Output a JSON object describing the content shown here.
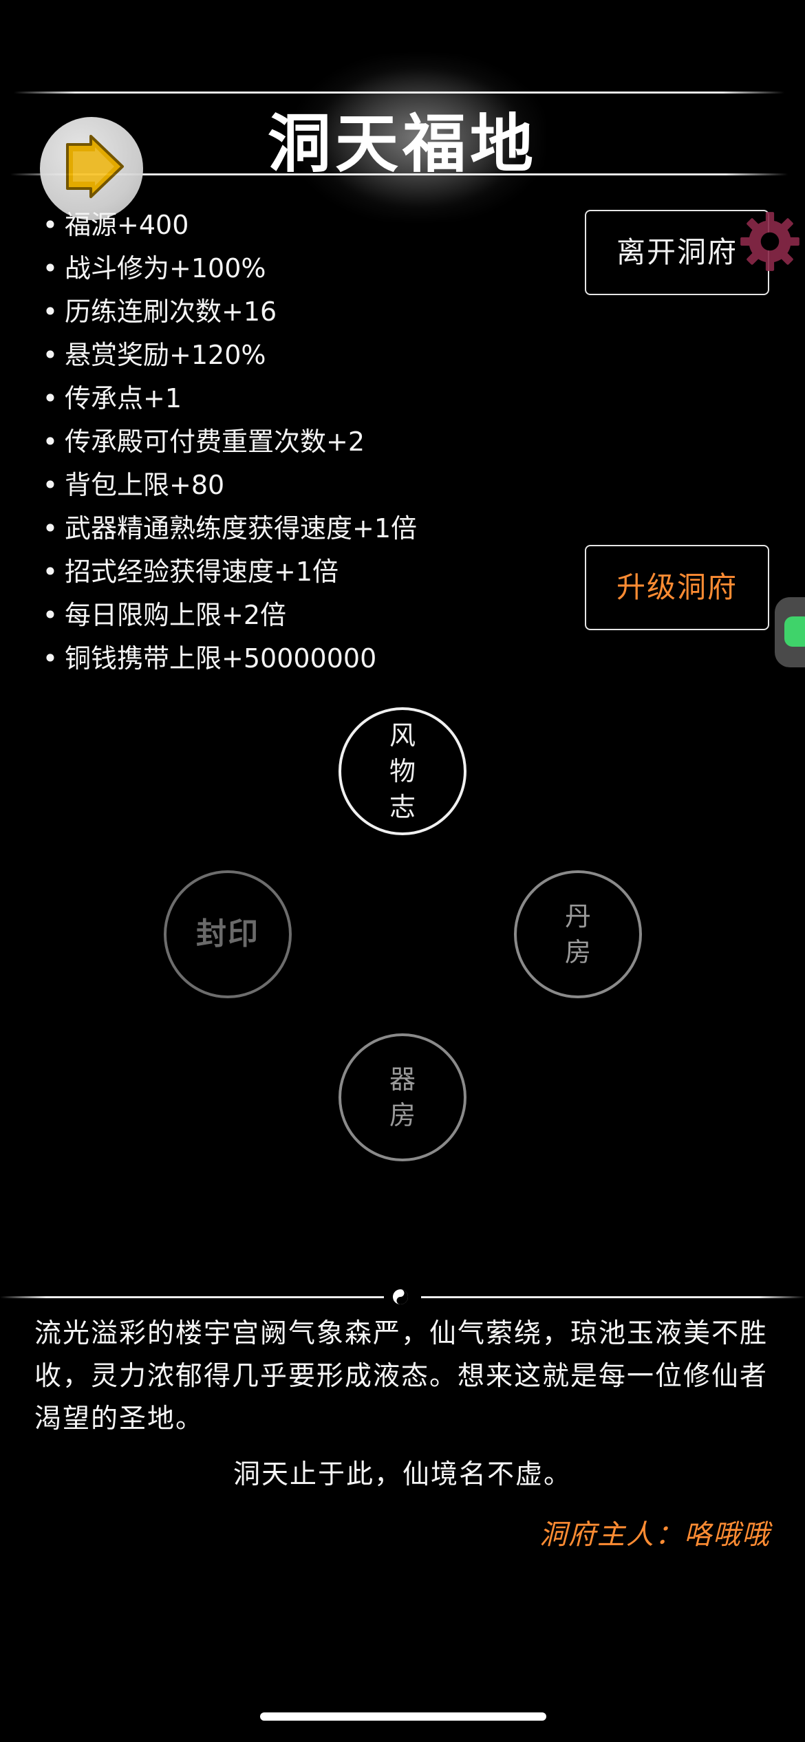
{
  "header": {
    "title": "洞天福地"
  },
  "buffs": [
    "福源+400",
    "战斗修为+100%",
    "历练连刷次数+16",
    "悬赏奖励+120%",
    "传承点+1",
    "传承殿可付费重置次数+2",
    "背包上限+80",
    "武器精通熟练度获得速度+1倍",
    "招式经验获得速度+1倍",
    "每日限购上限+2倍",
    "铜钱携带上限+50000000"
  ],
  "buttons": {
    "leave": "离开洞府",
    "upgrade": "升级洞府"
  },
  "circles": {
    "fengwu": [
      "风",
      "物",
      "志"
    ],
    "fengyin": [
      "封印"
    ],
    "danfang": [
      "丹",
      "房"
    ],
    "qifang": [
      "器",
      "房"
    ]
  },
  "description": {
    "text": "流光溢彩的楼宇宫阙气象森严，仙气萦绕，琼池玉液美不胜收，灵力浓郁得几乎要形成液态。想来这就是每一位修仙者渴望的圣地。",
    "poem": "洞天止于此，仙境名不虚。",
    "owner": "洞府主人：咯哦哦"
  },
  "icons": {
    "back": "back-arrow-icon",
    "gear": "gear-icon",
    "chat": "chat-icon",
    "divider": "yinyang-icon"
  },
  "colors": {
    "accent": "#ff8c33",
    "background": "#000000"
  }
}
